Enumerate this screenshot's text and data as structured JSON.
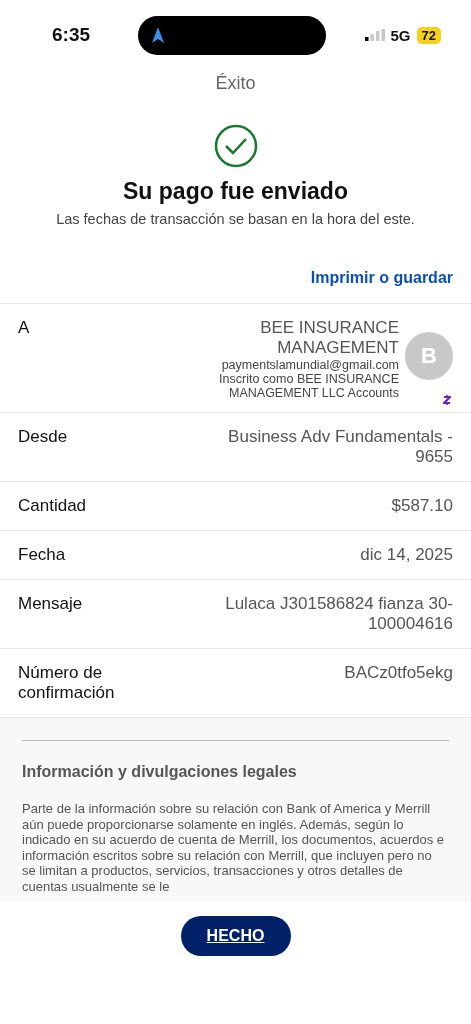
{
  "status_bar": {
    "time": "6:35",
    "network": "5G",
    "battery": "72"
  },
  "header": {
    "title": "Éxito"
  },
  "success": {
    "heading": "Su pago fue enviado",
    "note": "Las fechas de transacción se basan en la hora del este."
  },
  "print_link": "Imprimir o guardar",
  "recipient": {
    "label": "A",
    "name": "BEE INSURANCE MANAGEMENT",
    "email": "paymentslamundial@gmail.com",
    "enrolled": "Inscrito como BEE INSURANCE MANAGEMENT LLC Accounts",
    "avatar": "B"
  },
  "details": [
    {
      "label": "Desde",
      "value": "Business Adv Fundamentals - 9655"
    },
    {
      "label": "Cantidad",
      "value": "$587.10"
    },
    {
      "label": "Fecha",
      "value": "dic 14, 2025"
    },
    {
      "label": "Mensaje",
      "value": "Lulaca J301586824 fianza 30-100004616"
    },
    {
      "label": "Número de confirmación",
      "value": "BACz0tfo5ekg"
    }
  ],
  "legal": {
    "heading": "Información y divulgaciones legales",
    "text": "Parte de la información sobre su relación con Bank of America y Merrill aún puede proporcionarse solamente en inglés. Además, según lo indicado en su acuerdo de cuenta de Merrill, los documentos, acuerdos e información escritos sobre su relación con Merrill, que incluyen pero no se limitan a productos, servicios, transacciones y otros detalles de cuentas usualmente se le"
  },
  "done_button": "HECHO"
}
